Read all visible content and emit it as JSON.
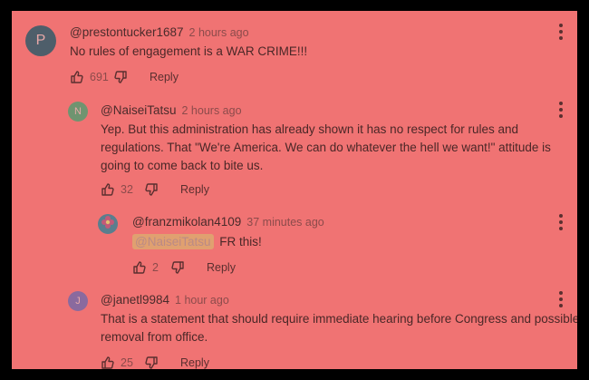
{
  "comments": [
    {
      "avatar_letter": "P",
      "avatar_color": "#4e5e6a",
      "handle": "@prestontucker1687",
      "time": "2 hours ago",
      "text": "No rules of engagement is a WAR CRIME!!!",
      "likes": "691",
      "reply_label": "Reply"
    },
    {
      "avatar_letter": "N",
      "avatar_color": "#6f9470",
      "handle": "@NaiseiTatsu",
      "time": "2 hours ago",
      "text": "Yep. But this administration has already shown it has no respect for rules and regulations. That \"We're America. We can do whatever the hell we want!\" attitude is going to come back to bite us.",
      "likes": "32",
      "reply_label": "Reply"
    },
    {
      "avatar_icon": "flower-avatar-icon",
      "handle": "@franzmikolan4109",
      "time": "37 minutes ago",
      "mention": "@NaiseiTatsu",
      "text": "FR this!",
      "likes": "2",
      "reply_label": "Reply"
    },
    {
      "avatar_letter": "J",
      "avatar_color": "#8a6a9e",
      "handle": "@janetl9984",
      "time": "1 hour ago",
      "text": "That is a statement that should require immediate hearing before Congress and possible removal from office.",
      "likes": "25",
      "reply_label": "Reply"
    }
  ],
  "icons": [
    "thumbs-up-icon",
    "thumbs-down-icon",
    "more-vertical-icon"
  ],
  "colors": {
    "background": "#f07373",
    "frame": "#000000",
    "text": "#4a2727",
    "muted": "#8c4b4b"
  }
}
